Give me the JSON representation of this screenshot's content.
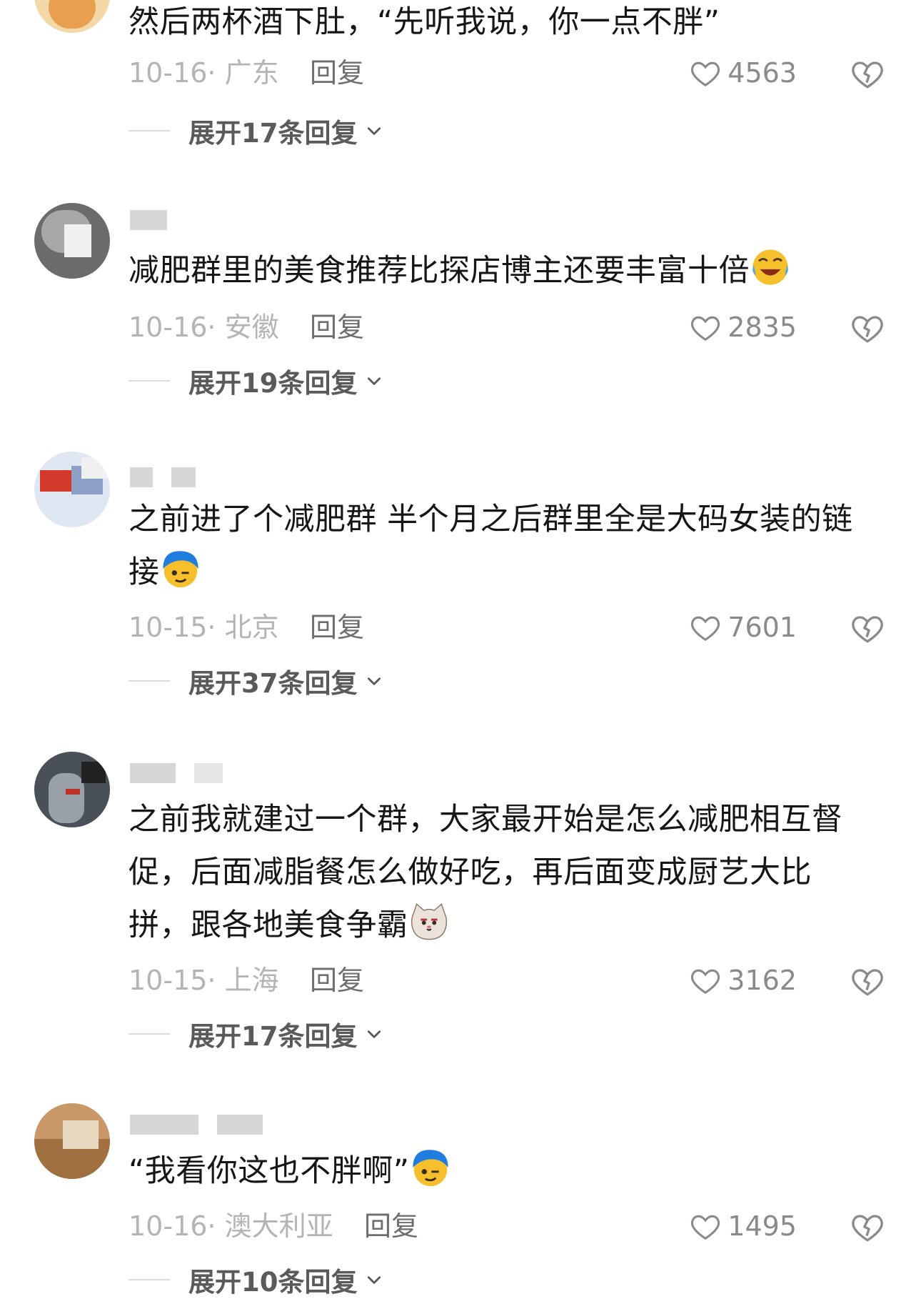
{
  "comments": [
    {
      "text": "然后两杯酒下肚，“先听我说，你一点不胖”",
      "date": "10-16",
      "location": "广东",
      "reply_label": "回复",
      "likes": "4563",
      "expand_label": "展开17条回复",
      "emoji": ""
    },
    {
      "text": "减肥群里的美食推荐比探店博主还要丰富十倍",
      "date": "10-16",
      "location": "安徽",
      "reply_label": "回复",
      "likes": "2835",
      "expand_label": "展开19条回复",
      "emoji": "crying-laughing-emoji"
    },
    {
      "text": "之前进了个减肥群 半个月之后群里全是大码女装的链接",
      "date": "10-15",
      "location": "北京",
      "reply_label": "回复",
      "likes": "7601",
      "expand_label": "展开37条回复",
      "emoji": "blue-hair-smirk-emoji"
    },
    {
      "text": "之前我就建过一个群，大家最开始是怎么减肥相互督促，后面减脂餐怎么做好吃，再后面变成厨艺大比拼，跟各地美食争霸",
      "date": "10-15",
      "location": "上海",
      "reply_label": "回复",
      "likes": "3162",
      "expand_label": "展开17条回复",
      "emoji": "smug-cat-emoji"
    },
    {
      "text": "“我看你这也不胖啊”",
      "date": "10-16",
      "location": "澳大利亚",
      "reply_label": "回复",
      "likes": "1495",
      "expand_label": "展开10条回复",
      "emoji": "blue-hair-smirk-emoji"
    }
  ],
  "colors": {
    "text": "#161616",
    "meta": "#b4b4b4",
    "reply": "#6e6e6e",
    "icon": "#8a8a8a"
  }
}
